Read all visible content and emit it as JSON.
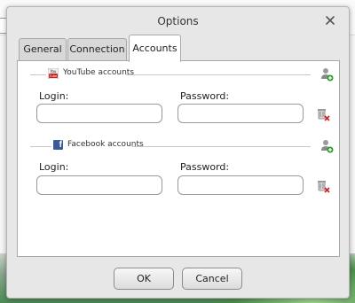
{
  "dialog": {
    "title": "Options",
    "close_glyph": "×"
  },
  "tabs": [
    {
      "label": "General",
      "active": false
    },
    {
      "label": "Connection",
      "active": false
    },
    {
      "label": "Accounts",
      "active": true
    }
  ],
  "accounts": {
    "youtube": {
      "section_title": "YouTube accounts",
      "icon_text": "You\nTube",
      "login_label": "Login:",
      "password_label": "Password:",
      "login_value": "",
      "password_value": ""
    },
    "facebook": {
      "section_title": "Facebook accounts",
      "icon_text": "f",
      "login_label": "Login:",
      "password_label": "Password:",
      "login_value": "",
      "password_value": ""
    }
  },
  "buttons": {
    "ok": "OK",
    "cancel": "Cancel"
  },
  "icons": {
    "close": "close-icon",
    "add_user": "add-user-icon",
    "delete_user": "delete-user-icon",
    "youtube": "youtube-icon",
    "facebook": "facebook-icon"
  },
  "colors": {
    "facebook_blue": "#3b5998",
    "youtube_red": "#cc2222",
    "add_green": "#2e9a2e",
    "delete_red": "#cc1f1f"
  }
}
